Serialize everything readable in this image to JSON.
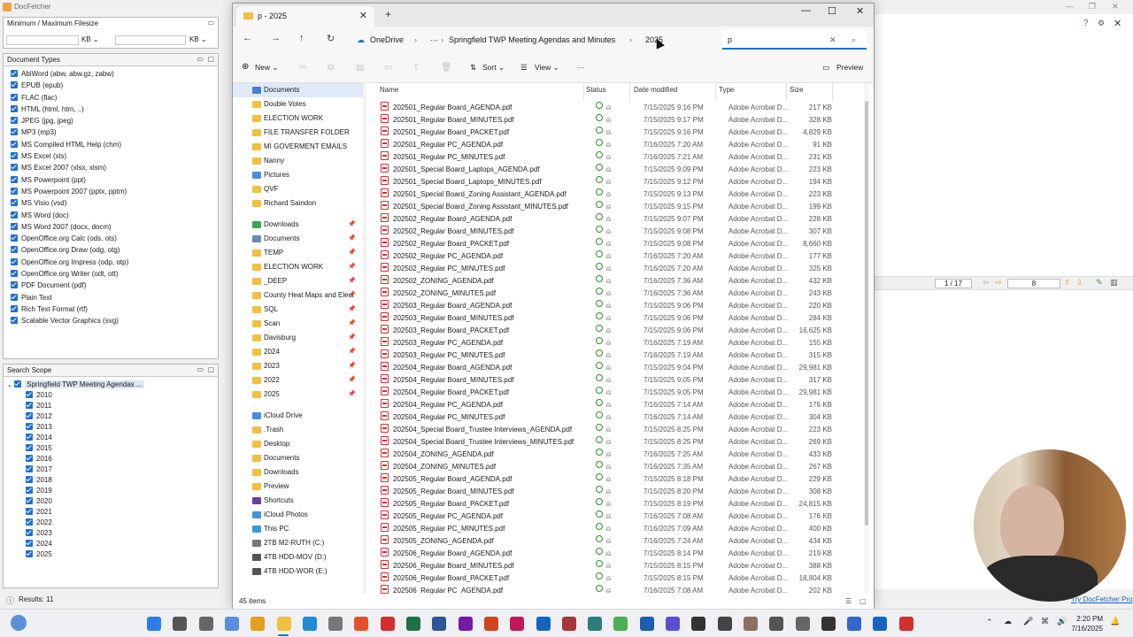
{
  "docfetcher": {
    "title": "DocFetcher",
    "filesize": {
      "header": "Minimum / Maximum Filesize",
      "unit_min": "KB",
      "unit_max": "KB"
    },
    "doc_types": {
      "header": "Document Types",
      "items": [
        "AbiWord (abw, abw.gz, zabw)",
        "EPUB (epub)",
        "FLAC (flac)",
        "HTML (html, htm, ..)",
        "JPEG (jpg, jpeg)",
        "MP3 (mp3)",
        "MS Compiled HTML Help (chm)",
        "MS Excel (xls)",
        "MS Excel 2007 (xlsx, xlsm)",
        "MS Powerpoint (ppt)",
        "MS Powerpoint 2007 (pptx, pptm)",
        "MS Visio (vsd)",
        "MS Word (doc)",
        "MS Word 2007 (docx, docm)",
        "OpenOffice.org Calc (ods, ots)",
        "OpenOffice.org Draw (odg, otg)",
        "OpenOffice.org Impress (odp, otp)",
        "OpenOffice.org Writer (odt, ott)",
        "PDF Document (pdf)",
        "Plain Text",
        "Rich Text Format (rtf)",
        "Scalable Vector Graphics (svg)"
      ]
    },
    "search_scope": {
      "header": "Search Scope",
      "root": "Springfield TWP Meeting Agendas ...",
      "years": [
        "2010",
        "2011",
        "2012",
        "2013",
        "2014",
        "2015",
        "2016",
        "2017",
        "2018",
        "2019",
        "2020",
        "2021",
        "2022",
        "2023",
        "2024",
        "2025"
      ]
    },
    "page_nav": {
      "page": "1 / 17",
      "value": "8"
    },
    "results": "Results: 11",
    "link": "Try DocFetcher Pro"
  },
  "explorer": {
    "tab_title": "p - 2025",
    "breadcrumb": [
      "OneDrive",
      "···",
      "Springfield TWP Meeting Agendas and Minutes",
      "2025"
    ],
    "search_value": "p",
    "commands": {
      "new": "New",
      "sort": "Sort",
      "view": "View",
      "more": "···",
      "preview": "Preview"
    },
    "nav_pane": [
      {
        "label": "Documents",
        "color": "#4a7fd4",
        "selected": true
      },
      {
        "label": "Double Votes",
        "color": "#f0c040"
      },
      {
        "label": "ELECTION WORK",
        "color": "#f0c040"
      },
      {
        "label": "FILE TRANSFER FOLDER",
        "color": "#f0c040"
      },
      {
        "label": "MI GOVERMENT EMAILS",
        "color": "#f0c040"
      },
      {
        "label": "Nanny",
        "color": "#f0c040"
      },
      {
        "label": "Pictures",
        "color": "#4a90d9"
      },
      {
        "label": "QVF",
        "color": "#f0c040"
      },
      {
        "label": "Richard Saindon",
        "color": "#f0c040"
      },
      {
        "label": "",
        "color": ""
      },
      {
        "label": "Downloads",
        "color": "#3aa55a",
        "pin": true
      },
      {
        "label": "Documents",
        "color": "#6a8ab0",
        "pin": true
      },
      {
        "label": "TEMP",
        "color": "#f0c040",
        "pin": true
      },
      {
        "label": "ELECTION WORK",
        "color": "#f0c040",
        "pin": true
      },
      {
        "label": "_DEEP",
        "color": "#f0c040",
        "pin": true
      },
      {
        "label": "County Heat Maps and Elect",
        "color": "#f0c040",
        "pin": true
      },
      {
        "label": "SQL",
        "color": "#f0c040",
        "pin": true
      },
      {
        "label": "Scan",
        "color": "#f0c040",
        "pin": true
      },
      {
        "label": "Davisburg",
        "color": "#f0c040",
        "pin": true
      },
      {
        "label": "2024",
        "color": "#f0c040",
        "pin": true
      },
      {
        "label": "2023",
        "color": "#f0c040",
        "pin": true
      },
      {
        "label": "2022",
        "color": "#f0c040",
        "pin": true
      },
      {
        "label": "2025",
        "color": "#f0c040",
        "pin": true
      },
      {
        "label": "",
        "color": ""
      },
      {
        "label": "iCloud Drive",
        "color": "#4a90d9"
      },
      {
        "label": ".Trash",
        "color": "#f0c040"
      },
      {
        "label": "Desktop",
        "color": "#f0c040"
      },
      {
        "label": "Documents",
        "color": "#f0c040"
      },
      {
        "label": "Downloads",
        "color": "#f0c040"
      },
      {
        "label": "Preview",
        "color": "#f0c040"
      },
      {
        "label": "Shortcuts",
        "color": "#6b3fa0"
      },
      {
        "label": "iCloud Photos",
        "color": "#4a90d9"
      },
      {
        "label": "This PC",
        "color": "#3a9ad9"
      },
      {
        "label": "2TB M2-RUTH (C:)",
        "color": "#777"
      },
      {
        "label": "4TB HDD-MOV (D:)",
        "color": "#555"
      },
      {
        "label": "4TB HDD-WOR (E:)",
        "color": "#555"
      }
    ],
    "columns": {
      "name": "Name",
      "status": "Status",
      "date": "Date modified",
      "type": "Type",
      "size": "Size"
    },
    "files": [
      [
        "202501_Regular Board_AGENDA.pdf",
        "7/15/2025 9:16 PM",
        "217 KB"
      ],
      [
        "202501_Regular Board_MINUTES.pdf",
        "7/15/2025 9:17 PM",
        "328 KB"
      ],
      [
        "202501_Regular Board_PACKET.pdf",
        "7/15/2025 9:16 PM",
        "4,829 KB"
      ],
      [
        "202501_Regular PC_AGENDA.pdf",
        "7/16/2025 7:20 AM",
        "91 KB"
      ],
      [
        "202501_Regular PC_MINUTES.pdf",
        "7/16/2025 7:21 AM",
        "231 KB"
      ],
      [
        "202501_Special Board_Laptops_AGENDA.pdf",
        "7/15/2025 9:09 PM",
        "223 KB"
      ],
      [
        "202501_Special Board_Laptops_MINUTES.pdf",
        "7/15/2025 9:12 PM",
        "194 KB"
      ],
      [
        "202501_Special Board_Zoning Assistant_AGENDA.pdf",
        "7/15/2025 9:13 PM",
        "223 KB"
      ],
      [
        "202501_Special Board_Zoning Assistant_MINUTES.pdf",
        "7/15/2025 9:15 PM",
        "199 KB"
      ],
      [
        "202502_Regular Board_AGENDA.pdf",
        "7/15/2025 9:07 PM",
        "228 KB"
      ],
      [
        "202502_Regular Board_MINUTES.pdf",
        "7/15/2025 9:08 PM",
        "307 KB"
      ],
      [
        "202502_Regular Board_PACKET.pdf",
        "7/15/2025 9:08 PM",
        "8,660 KB"
      ],
      [
        "202502_Regular PC_AGENDA.pdf",
        "7/16/2025 7:20 AM",
        "177 KB"
      ],
      [
        "202502_Regular PC_MINUTES.pdf",
        "7/16/2025 7:20 AM",
        "325 KB"
      ],
      [
        "202502_ZONING_AGENDA.pdf",
        "7/16/2025 7:36 AM",
        "432 KB"
      ],
      [
        "202502_ZONING_MINUTES.pdf",
        "7/16/2025 7:36 AM",
        "243 KB"
      ],
      [
        "202503_Regular Board_AGENDA.pdf",
        "7/15/2025 9:06 PM",
        "220 KB"
      ],
      [
        "202503_Regular Board_MINUTES.pdf",
        "7/15/2025 9:06 PM",
        "284 KB"
      ],
      [
        "202503_Regular Board_PACKET.pdf",
        "7/15/2025 9:06 PM",
        "16,625 KB"
      ],
      [
        "202503_Regular PC_AGENDA.pdf",
        "7/16/2025 7:19 AM",
        "155 KB"
      ],
      [
        "202503_Regular PC_MINUTES.pdf",
        "7/16/2025 7:19 AM",
        "315 KB"
      ],
      [
        "202504_Regular Board_AGENDA.pdf",
        "7/15/2025 9:04 PM",
        "29,981 KB"
      ],
      [
        "202504_Regular Board_MINUTES.pdf",
        "7/15/2025 9:05 PM",
        "317 KB"
      ],
      [
        "202504_Regular Board_PACKET.pdf",
        "7/15/2025 9:05 PM",
        "29,981 KB"
      ],
      [
        "202504_Regular PC_AGENDA.pdf",
        "7/16/2025 7:14 AM",
        "176 KB"
      ],
      [
        "202504_Regular PC_MINUTES.pdf",
        "7/16/2025 7:14 AM",
        "304 KB"
      ],
      [
        "202504_Special Board_Trustee Interviews_AGENDA.pdf",
        "7/15/2025 8:25 PM",
        "223 KB"
      ],
      [
        "202504_Special Board_Trustee Interviews_MINUTES.pdf",
        "7/15/2025 8:25 PM",
        "269 KB"
      ],
      [
        "202504_ZONING_AGENDA.pdf",
        "7/16/2025 7:25 AM",
        "433 KB"
      ],
      [
        "202504_ZONING_MINUTES.pdf",
        "7/16/2025 7:35 AM",
        "267 KB"
      ],
      [
        "202505_Regular Board_AGENDA.pdf",
        "7/15/2025 8:18 PM",
        "229 KB"
      ],
      [
        "202505_Regular Board_MINUTES.pdf",
        "7/15/2025 8:20 PM",
        "308 KB"
      ],
      [
        "202505_Regular Board_PACKET.pdf",
        "7/15/2025 8:19 PM",
        "24,815 KB"
      ],
      [
        "202505_Regular PC_AGENDA.pdf",
        "7/16/2025 7:08 AM",
        "176 KB"
      ],
      [
        "202505_Regular PC_MINUTES.pdf",
        "7/16/2025 7:09 AM",
        "400 KB"
      ],
      [
        "202505_ZONING_AGENDA.pdf",
        "7/16/2025 7:24 AM",
        "434 KB"
      ],
      [
        "202506_Regular Board_AGENDA.pdf",
        "7/15/2025 8:14 PM",
        "219 KB"
      ],
      [
        "202506_Regular Board_MINUTES.pdf",
        "7/15/2025 8:15 PM",
        "388 KB"
      ],
      [
        "202506_Regular Board_PACKET.pdf",
        "7/15/2025 8:15 PM",
        "18,804 KB"
      ],
      [
        "202506_Regular PC_AGENDA.pdf",
        "7/16/2025 7:08 AM",
        "202 KB"
      ]
    ],
    "file_type": "Adobe Acrobat D...",
    "status_text": "45 items"
  },
  "taskbar": {
    "time": "2:20 PM",
    "date": "7/16/2025",
    "icons": [
      {
        "name": "start-icon",
        "color": "#2b7de9"
      },
      {
        "name": "search-icon",
        "color": "#555"
      },
      {
        "name": "task-view-icon",
        "color": "#666"
      },
      {
        "name": "copilot-icon",
        "color": "#5a8fe0"
      },
      {
        "name": "chrome-icon",
        "color": "#e0a020"
      },
      {
        "name": "file-explorer-icon",
        "color": "#f0c040"
      },
      {
        "name": "edge-icon",
        "color": "#1f8ad6"
      },
      {
        "name": "store-icon",
        "color": "#777"
      },
      {
        "name": "brave-icon",
        "color": "#e0522a"
      },
      {
        "name": "acrobat-icon",
        "color": "#d32f2f"
      },
      {
        "name": "excel-icon",
        "color": "#1e7145"
      },
      {
        "name": "word-icon",
        "color": "#2b579a"
      },
      {
        "name": "onenote-icon",
        "color": "#7719aa"
      },
      {
        "name": "powerpoint-icon",
        "color": "#d04423"
      },
      {
        "name": "app-r-icon",
        "color": "#c2185b"
      },
      {
        "name": "app-n-icon",
        "color": "#1565c0"
      },
      {
        "name": "access-icon",
        "color": "#a4373a"
      },
      {
        "name": "app-teal-icon",
        "color": "#2e7d7d"
      },
      {
        "name": "notepad-icon",
        "color": "#4caf50"
      },
      {
        "name": "app-blue-icon",
        "color": "#1a5fb4"
      },
      {
        "name": "app-purple-icon",
        "color": "#5b4fd0"
      },
      {
        "name": "gauge-icon",
        "color": "#333"
      },
      {
        "name": "app-monitor-icon",
        "color": "#444"
      },
      {
        "name": "owl-icon",
        "color": "#8d6e63"
      },
      {
        "name": "app-dark-icon",
        "color": "#555"
      },
      {
        "name": "tools-icon",
        "color": "#666"
      },
      {
        "name": "app-dark2-icon",
        "color": "#333"
      },
      {
        "name": "app-blue2-icon",
        "color": "#3366cc"
      },
      {
        "name": "app-s-icon",
        "color": "#1565c0"
      },
      {
        "name": "app-s-red-icon",
        "color": "#d32f2f"
      }
    ]
  }
}
